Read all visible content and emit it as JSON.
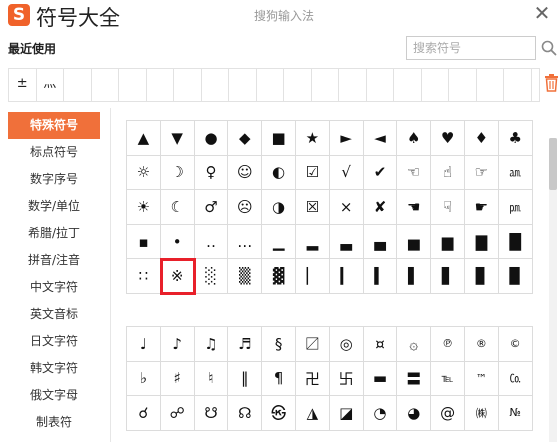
{
  "app": {
    "title": "符号大全",
    "center_title": "搜狗输入法",
    "logo_letter": "S",
    "brand_color": "#f0622a"
  },
  "recent": {
    "label": "最近使用",
    "items": [
      "±",
      "灬",
      "",
      "",
      "",
      "",
      "",
      "",
      "",
      "",
      "",
      "",
      "",
      "",
      "",
      "",
      "",
      "",
      ""
    ]
  },
  "search": {
    "placeholder": "搜索符号",
    "value": ""
  },
  "sidebar": {
    "items": [
      {
        "label": "特殊符号",
        "active": true
      },
      {
        "label": "标点符号",
        "active": false
      },
      {
        "label": "数字序号",
        "active": false
      },
      {
        "label": "数学/单位",
        "active": false
      },
      {
        "label": "希腊/拉丁",
        "active": false
      },
      {
        "label": "拼音/注音",
        "active": false
      },
      {
        "label": "中文字符",
        "active": false
      },
      {
        "label": "英文音标",
        "active": false
      },
      {
        "label": "日文字符",
        "active": false
      },
      {
        "label": "韩文字符",
        "active": false
      },
      {
        "label": "俄文字母",
        "active": false
      },
      {
        "label": "制表符",
        "active": false
      }
    ]
  },
  "groups": [
    {
      "rows": [
        [
          "▲",
          "▼",
          "●",
          "◆",
          "■",
          "★",
          "►",
          "◄",
          "♠",
          "♥",
          "♦",
          "♣"
        ],
        [
          "☼",
          "☽",
          "♀",
          "☺",
          "◐",
          "☑",
          "√",
          "✔",
          "☜",
          "☝",
          "☞",
          "㏂"
        ],
        [
          "☀",
          "☾",
          "♂",
          "☹",
          "◑",
          "☒",
          "×",
          "✘",
          "☚",
          "☟",
          "☛",
          "㏘"
        ],
        [
          "▪",
          "•",
          "‥",
          "…",
          "▁",
          "▂",
          "▃",
          "▄",
          "▅",
          "▆",
          "▇",
          "█"
        ],
        [
          "∷",
          "※",
          "░",
          "▒",
          "▓",
          "▏",
          "▎",
          "▍",
          "▌",
          "▋",
          "▊",
          "▉"
        ]
      ],
      "selected": [
        4,
        1
      ]
    },
    {
      "rows": [
        [
          "♩",
          "♪",
          "♫",
          "♬",
          "§",
          "〼",
          "◎",
          "¤",
          "۞",
          "℗",
          "®",
          "©"
        ],
        [
          "♭",
          "♯",
          "♮",
          "‖",
          "¶",
          "卍",
          "卐",
          "▬",
          "〓",
          "℡",
          "™",
          "㏇"
        ],
        [
          "☌",
          "☍",
          "☋",
          "☊",
          "㉿",
          "◮",
          "◪",
          "◔",
          "◕",
          "@",
          "㈱",
          "№"
        ]
      ],
      "selected": null
    }
  ],
  "colors": {
    "accent": "#f0703a",
    "selected_border": "#e8202a",
    "trash_icon": "#f0703a"
  }
}
